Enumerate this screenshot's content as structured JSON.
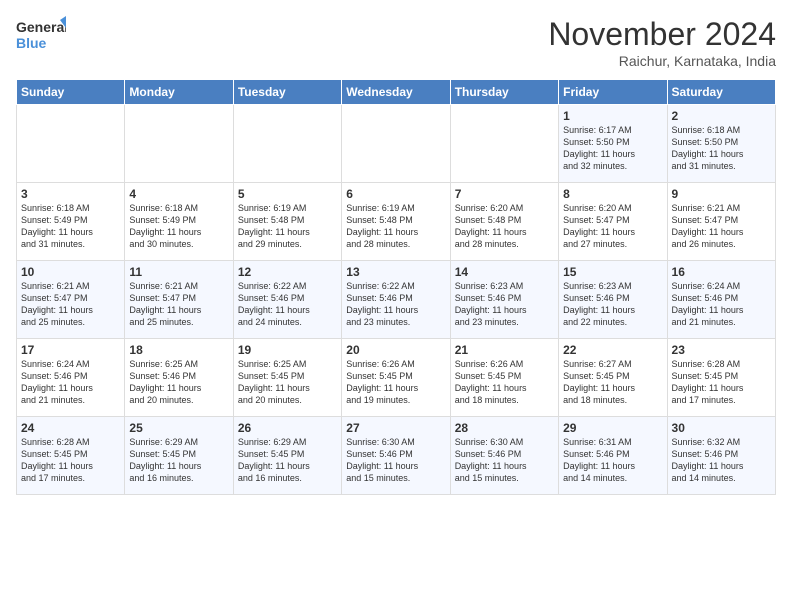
{
  "logo": {
    "line1": "General",
    "line2": "Blue"
  },
  "title": "November 2024",
  "subtitle": "Raichur, Karnataka, India",
  "days_header": [
    "Sunday",
    "Monday",
    "Tuesday",
    "Wednesday",
    "Thursday",
    "Friday",
    "Saturday"
  ],
  "weeks": [
    [
      {
        "day": "",
        "info": ""
      },
      {
        "day": "",
        "info": ""
      },
      {
        "day": "",
        "info": ""
      },
      {
        "day": "",
        "info": ""
      },
      {
        "day": "",
        "info": ""
      },
      {
        "day": "1",
        "info": "Sunrise: 6:17 AM\nSunset: 5:50 PM\nDaylight: 11 hours\nand 32 minutes."
      },
      {
        "day": "2",
        "info": "Sunrise: 6:18 AM\nSunset: 5:50 PM\nDaylight: 11 hours\nand 31 minutes."
      }
    ],
    [
      {
        "day": "3",
        "info": "Sunrise: 6:18 AM\nSunset: 5:49 PM\nDaylight: 11 hours\nand 31 minutes."
      },
      {
        "day": "4",
        "info": "Sunrise: 6:18 AM\nSunset: 5:49 PM\nDaylight: 11 hours\nand 30 minutes."
      },
      {
        "day": "5",
        "info": "Sunrise: 6:19 AM\nSunset: 5:48 PM\nDaylight: 11 hours\nand 29 minutes."
      },
      {
        "day": "6",
        "info": "Sunrise: 6:19 AM\nSunset: 5:48 PM\nDaylight: 11 hours\nand 28 minutes."
      },
      {
        "day": "7",
        "info": "Sunrise: 6:20 AM\nSunset: 5:48 PM\nDaylight: 11 hours\nand 28 minutes."
      },
      {
        "day": "8",
        "info": "Sunrise: 6:20 AM\nSunset: 5:47 PM\nDaylight: 11 hours\nand 27 minutes."
      },
      {
        "day": "9",
        "info": "Sunrise: 6:21 AM\nSunset: 5:47 PM\nDaylight: 11 hours\nand 26 minutes."
      }
    ],
    [
      {
        "day": "10",
        "info": "Sunrise: 6:21 AM\nSunset: 5:47 PM\nDaylight: 11 hours\nand 25 minutes."
      },
      {
        "day": "11",
        "info": "Sunrise: 6:21 AM\nSunset: 5:47 PM\nDaylight: 11 hours\nand 25 minutes."
      },
      {
        "day": "12",
        "info": "Sunrise: 6:22 AM\nSunset: 5:46 PM\nDaylight: 11 hours\nand 24 minutes."
      },
      {
        "day": "13",
        "info": "Sunrise: 6:22 AM\nSunset: 5:46 PM\nDaylight: 11 hours\nand 23 minutes."
      },
      {
        "day": "14",
        "info": "Sunrise: 6:23 AM\nSunset: 5:46 PM\nDaylight: 11 hours\nand 23 minutes."
      },
      {
        "day": "15",
        "info": "Sunrise: 6:23 AM\nSunset: 5:46 PM\nDaylight: 11 hours\nand 22 minutes."
      },
      {
        "day": "16",
        "info": "Sunrise: 6:24 AM\nSunset: 5:46 PM\nDaylight: 11 hours\nand 21 minutes."
      }
    ],
    [
      {
        "day": "17",
        "info": "Sunrise: 6:24 AM\nSunset: 5:46 PM\nDaylight: 11 hours\nand 21 minutes."
      },
      {
        "day": "18",
        "info": "Sunrise: 6:25 AM\nSunset: 5:46 PM\nDaylight: 11 hours\nand 20 minutes."
      },
      {
        "day": "19",
        "info": "Sunrise: 6:25 AM\nSunset: 5:45 PM\nDaylight: 11 hours\nand 20 minutes."
      },
      {
        "day": "20",
        "info": "Sunrise: 6:26 AM\nSunset: 5:45 PM\nDaylight: 11 hours\nand 19 minutes."
      },
      {
        "day": "21",
        "info": "Sunrise: 6:26 AM\nSunset: 5:45 PM\nDaylight: 11 hours\nand 18 minutes."
      },
      {
        "day": "22",
        "info": "Sunrise: 6:27 AM\nSunset: 5:45 PM\nDaylight: 11 hours\nand 18 minutes."
      },
      {
        "day": "23",
        "info": "Sunrise: 6:28 AM\nSunset: 5:45 PM\nDaylight: 11 hours\nand 17 minutes."
      }
    ],
    [
      {
        "day": "24",
        "info": "Sunrise: 6:28 AM\nSunset: 5:45 PM\nDaylight: 11 hours\nand 17 minutes."
      },
      {
        "day": "25",
        "info": "Sunrise: 6:29 AM\nSunset: 5:45 PM\nDaylight: 11 hours\nand 16 minutes."
      },
      {
        "day": "26",
        "info": "Sunrise: 6:29 AM\nSunset: 5:45 PM\nDaylight: 11 hours\nand 16 minutes."
      },
      {
        "day": "27",
        "info": "Sunrise: 6:30 AM\nSunset: 5:46 PM\nDaylight: 11 hours\nand 15 minutes."
      },
      {
        "day": "28",
        "info": "Sunrise: 6:30 AM\nSunset: 5:46 PM\nDaylight: 11 hours\nand 15 minutes."
      },
      {
        "day": "29",
        "info": "Sunrise: 6:31 AM\nSunset: 5:46 PM\nDaylight: 11 hours\nand 14 minutes."
      },
      {
        "day": "30",
        "info": "Sunrise: 6:32 AM\nSunset: 5:46 PM\nDaylight: 11 hours\nand 14 minutes."
      }
    ]
  ]
}
